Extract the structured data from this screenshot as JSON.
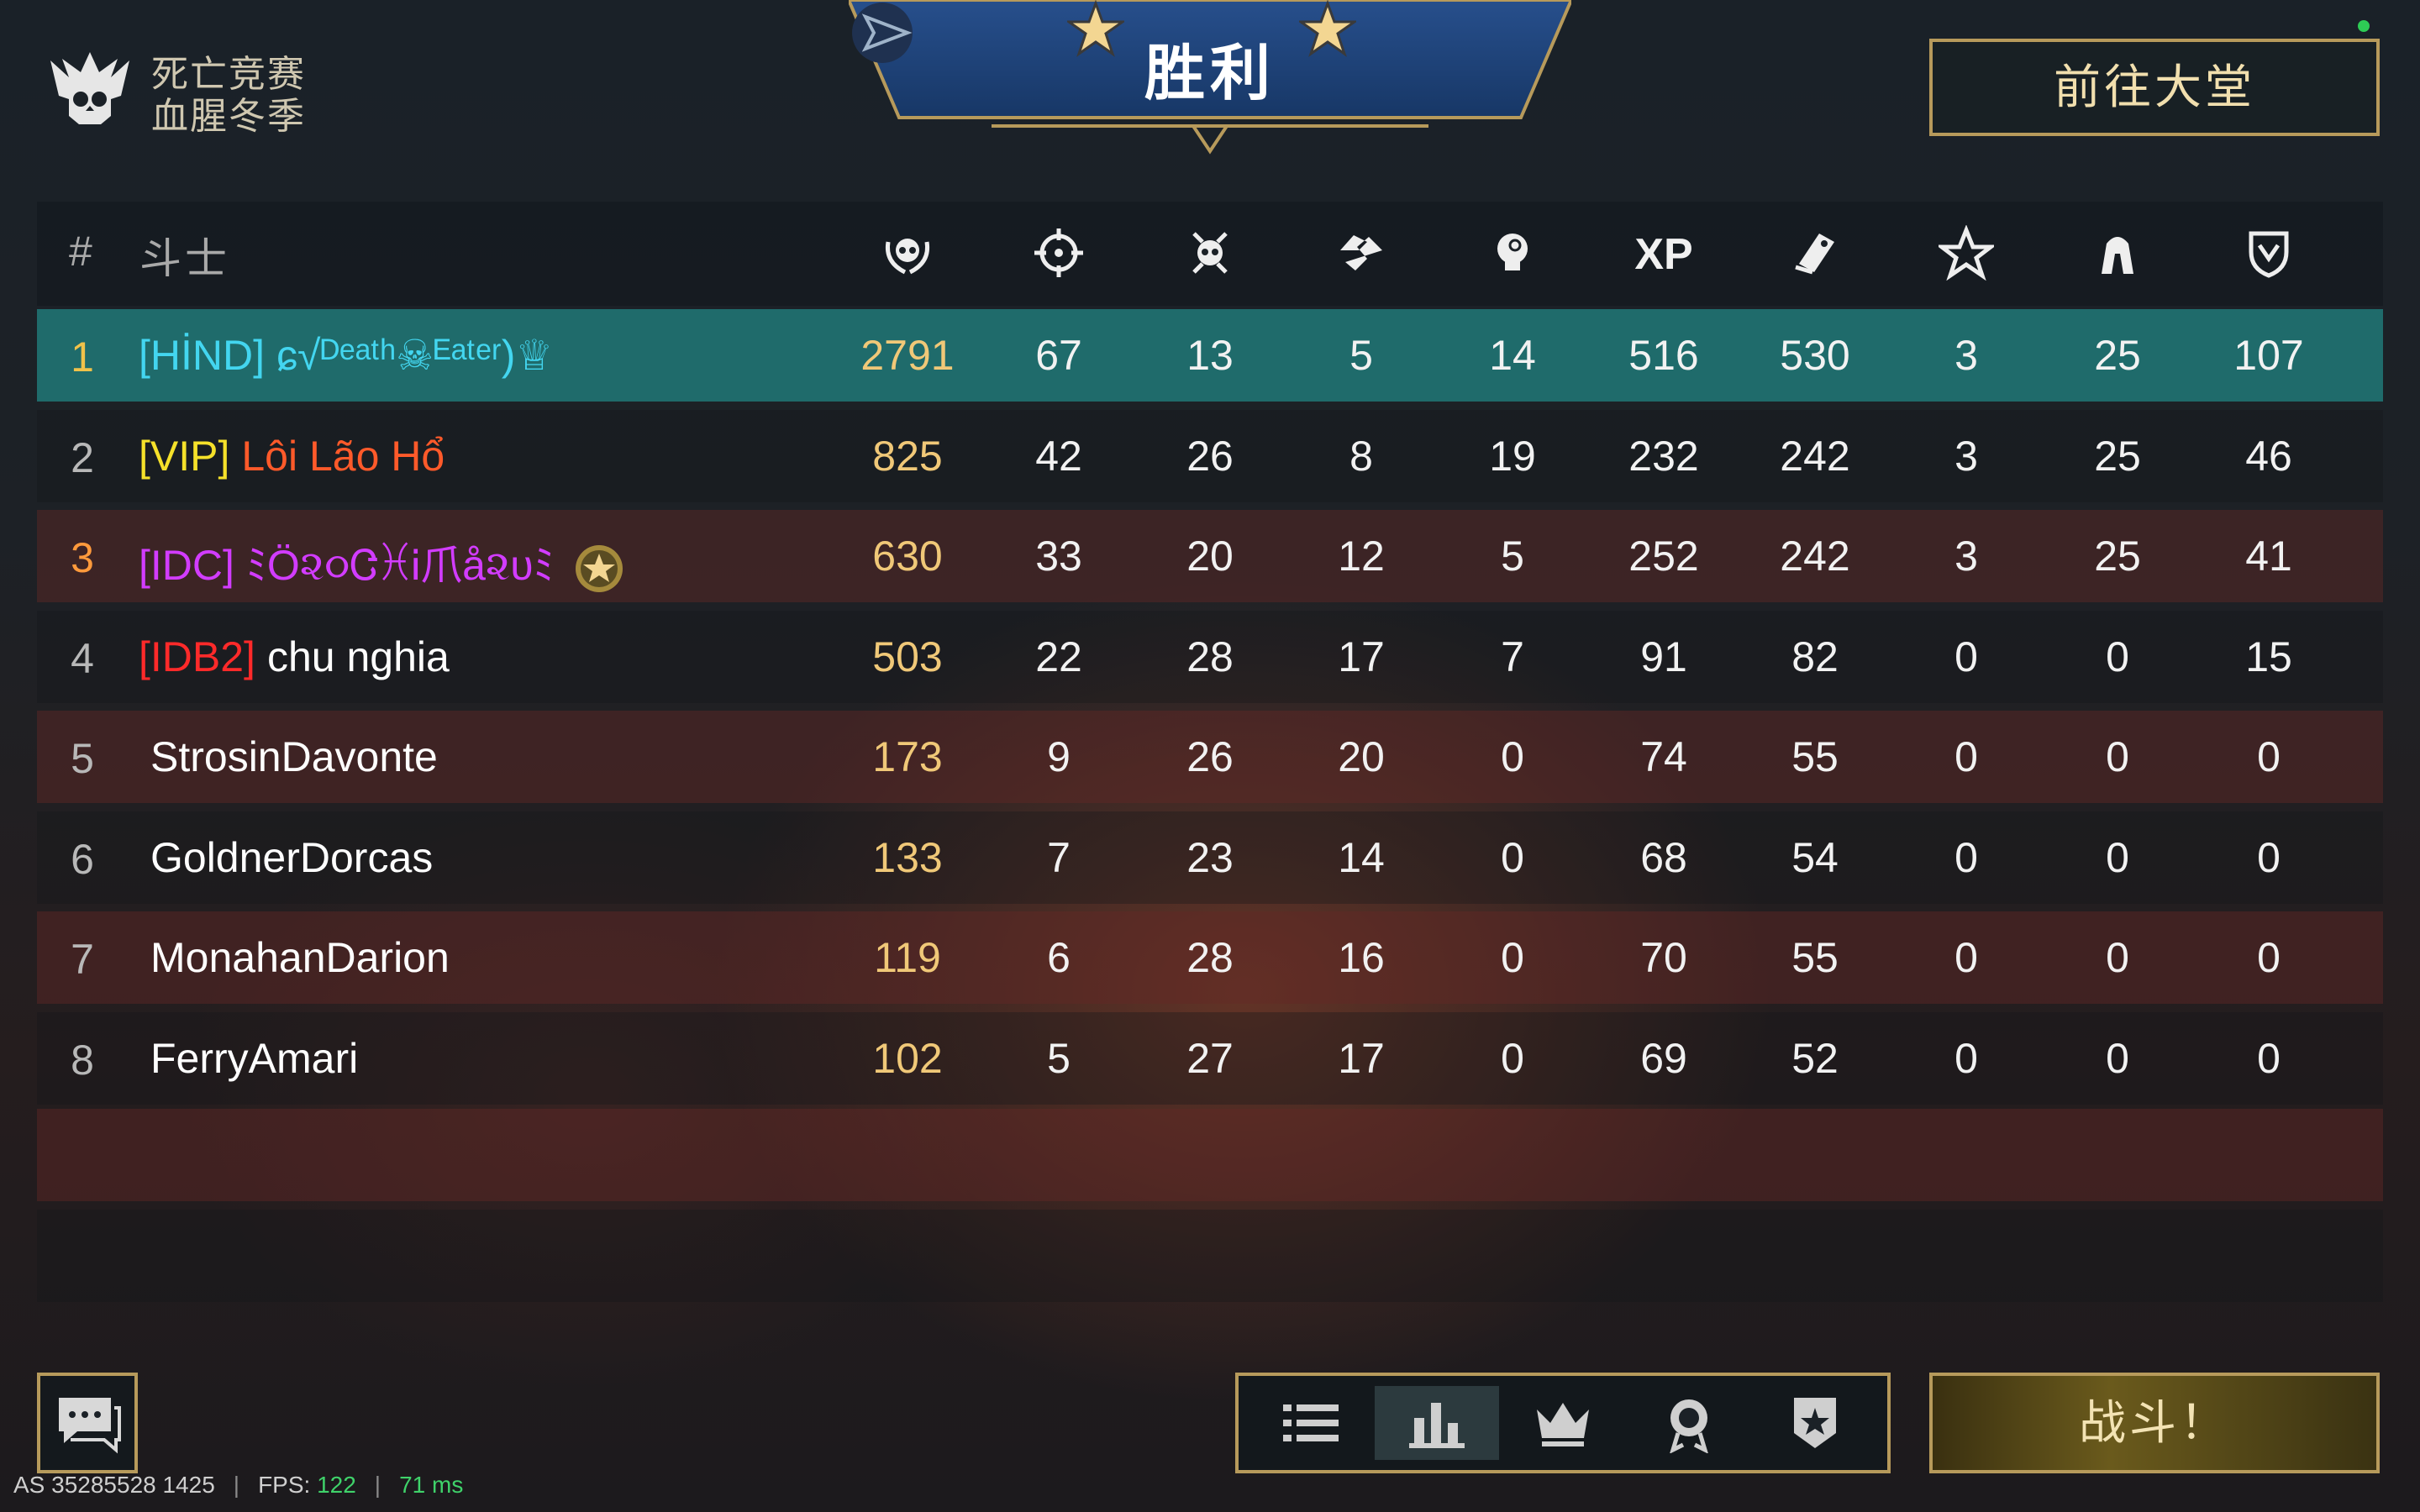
{
  "mode": {
    "line1": "死亡竞赛",
    "line2": "血腥冬季"
  },
  "banner": {
    "title": "胜利"
  },
  "lobby_button": "前往大堂",
  "fight_button": "战斗！",
  "table": {
    "header": {
      "rank": "#",
      "fighter": "斗士",
      "columns": [
        {
          "icon": "laurel-skull-icon"
        },
        {
          "icon": "crosshair-icon"
        },
        {
          "icon": "dead-skull-icon"
        },
        {
          "icon": "handshake-icon"
        },
        {
          "icon": "head-shot-icon"
        },
        {
          "icon": "xp-label",
          "label": "XP"
        },
        {
          "icon": "ticket-icon"
        },
        {
          "icon": "star-icon"
        },
        {
          "icon": "hood-icon"
        },
        {
          "icon": "shield-icon"
        }
      ]
    },
    "rows": [
      {
        "rank": "1",
        "tag": "[HİND]",
        "name": "ɕ√ᴰᵉᵃᵗʰ☠ᴱᵃᵗᵉʳ)♕",
        "values": [
          "2791",
          "67",
          "13",
          "5",
          "14",
          "516",
          "530",
          "3",
          "25",
          "107"
        ]
      },
      {
        "rank": "2",
        "tag": "[VIP]",
        "name": "Lôi Lão Hổ",
        "values": [
          "825",
          "42",
          "26",
          "8",
          "19",
          "232",
          "242",
          "3",
          "25",
          "46"
        ]
      },
      {
        "rank": "3",
        "tag": "[IDC]",
        "name": "ﾐÖ૨૦ᏣꁝᎥ爪å૨υﾐ",
        "values": [
          "630",
          "33",
          "20",
          "12",
          "5",
          "252",
          "242",
          "3",
          "25",
          "41"
        ]
      },
      {
        "rank": "4",
        "tag": "[IDB2]",
        "name": "chu nghia",
        "values": [
          "503",
          "22",
          "28",
          "17",
          "7",
          "91",
          "82",
          "0",
          "0",
          "15"
        ]
      },
      {
        "rank": "5",
        "tag": "",
        "name": "StrosinDavonte",
        "values": [
          "173",
          "9",
          "26",
          "20",
          "0",
          "74",
          "55",
          "0",
          "0",
          "0"
        ]
      },
      {
        "rank": "6",
        "tag": "",
        "name": "GoldnerDorcas",
        "values": [
          "133",
          "7",
          "23",
          "14",
          "0",
          "68",
          "54",
          "0",
          "0",
          "0"
        ]
      },
      {
        "rank": "7",
        "tag": "",
        "name": "MonahanDarion",
        "values": [
          "119",
          "6",
          "28",
          "16",
          "0",
          "70",
          "55",
          "0",
          "0",
          "0"
        ]
      },
      {
        "rank": "8",
        "tag": "",
        "name": "FerryAmari",
        "values": [
          "102",
          "5",
          "27",
          "17",
          "0",
          "69",
          "52",
          "0",
          "0",
          "0"
        ]
      }
    ]
  },
  "colors": {
    "rank1": "#f0c24a",
    "rank3": "#ff9a3c",
    "rank_other": "#b8b8b8",
    "tag_hind": "#43d6f0",
    "name_hind": "#43d6f0",
    "tag_vip": "#f5e12a",
    "name_vip": "#ff5a2a",
    "tag_idc": "#d23cff",
    "name_idc": "#d23cff",
    "tag_idb2": "#ff2a2a",
    "name_idb2": "#ffffff"
  },
  "tabs": [
    {
      "icon": "list-icon"
    },
    {
      "icon": "bar-chart-icon",
      "active": true
    },
    {
      "icon": "crown-icon"
    },
    {
      "icon": "medal-icon"
    },
    {
      "icon": "badge-star-icon"
    }
  ],
  "status": {
    "server": "AS 35285528 1425",
    "fps_label": "FPS:",
    "fps_value": "122",
    "ping": "71 ms"
  }
}
